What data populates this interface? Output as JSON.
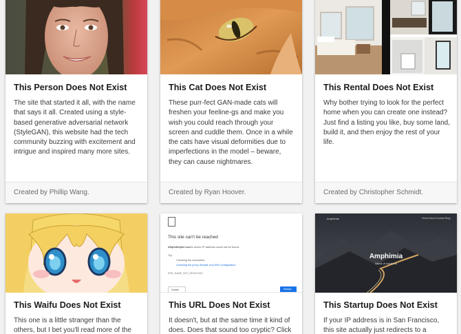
{
  "cards": [
    {
      "title": "This Person Does Not Exist",
      "description": "The site that started it all, with the name that says it all. Created using a style-based generative adversarial network (StyleGAN), this website had the tech community buzzing with excitement and intrigue and inspired many more sites.",
      "footer": "Created by Phillip Wang.",
      "image": "woman-face-photo"
    },
    {
      "title": "This Cat Does Not Exist",
      "description": "These purr-fect GAN-made cats will freshen your feeline-gs and make you wish you could reach through your screen and cuddle them. Once in a while the cats have visual deformities due to imperfections in the model – beware, they can cause nightmares.",
      "footer": "Created by Ryan Hoover.",
      "image": "orange-cat-photo"
    },
    {
      "title": "This Rental Does Not Exist",
      "description": "Why bother trying to look for the perfect home when you can create one instead? Just find a listing you like, buy some land, build it, and then enjoy the rest of your life.",
      "footer": "Created by Christopher Schmidt.",
      "image": "rental-interior-collage"
    },
    {
      "title": "This Waifu Does Not Exist",
      "description": "This one is a little stranger than the others, but I bet you'll read more of the plot",
      "image": "anime-girl-illustration"
    },
    {
      "title": "This URL Does Not Exist",
      "description": "It doesn't, but at the same time it kind of does. Does that sound too cryptic? Click on",
      "image": "browser-error-screenshot",
      "screenshot": {
        "heading": "This site can’t be reached",
        "message_host": "dfkjfsdlkfjskl.com",
        "message_rest": "'s server IP address could not be found.",
        "try_label": "Try:",
        "tip1": "Checking the connection",
        "tip2": "Checking the proxy, firewall, and DNS configuration",
        "error_code": "ERR_NAME_NOT_RESOLVED",
        "details_button": "Details",
        "reload_button": "Reload"
      }
    },
    {
      "title": "This Startup Does Not Exist",
      "description": "If your IP address is in San Francisco, this site actually just redirects to a random",
      "image": "mountain-road-hero",
      "screenshot": {
        "logo": "Amphimia",
        "nav": "Home   About   Contact   Blog",
        "hero_title": "Amphimia",
        "hero_subtitle": "About of solutions"
      }
    }
  ]
}
